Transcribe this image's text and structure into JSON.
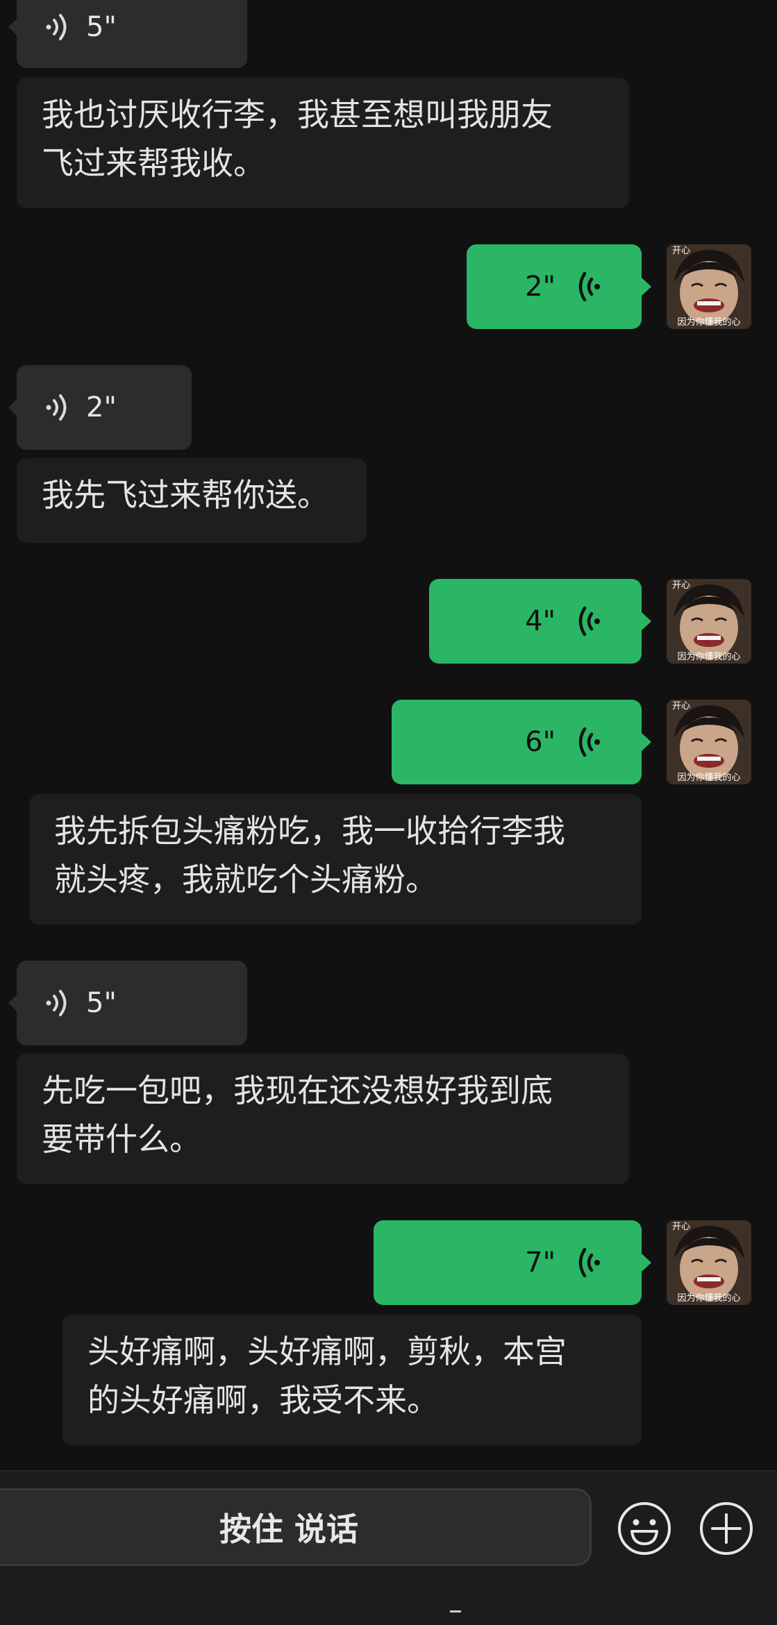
{
  "messages": {
    "m1": {
      "duration": "5\""
    },
    "m1_text": {
      "line1": "我也讨厌收行李，我甚至想叫我朋友",
      "line2": "飞过来帮我收。"
    },
    "m2": {
      "duration": "2\""
    },
    "m3": {
      "duration": "2\""
    },
    "m3_text": {
      "line1": "我先飞过来帮你送。"
    },
    "m4": {
      "duration": "4\""
    },
    "m5": {
      "duration": "6\""
    },
    "m5_text": {
      "line1": "我先拆包头痛粉吃，我一收拾行李我",
      "line2": "就头疼，我就吃个头痛粉。"
    },
    "m6": {
      "duration": "5\""
    },
    "m6_text": {
      "line1": "先吃一包吧，我现在还没想好我到底",
      "line2": "要带什么。"
    },
    "m7": {
      "duration": "7\""
    },
    "m7_text": {
      "line1": "头好痛啊，头好痛啊，剪秋，本宫",
      "line2": "的头好痛啊，我受不来。"
    }
  },
  "avatar": {
    "caption_top": "开心",
    "caption_bottom": "因为你懂我的心"
  },
  "bottom_bar": {
    "talk_label": "按住 说话",
    "emoji_icon": "smiley-icon",
    "plus_icon": "plus-icon"
  },
  "colors": {
    "background": "#111111",
    "outgoing_bubble": "#2bb665",
    "incoming_bubble": "#2c2c2c"
  }
}
